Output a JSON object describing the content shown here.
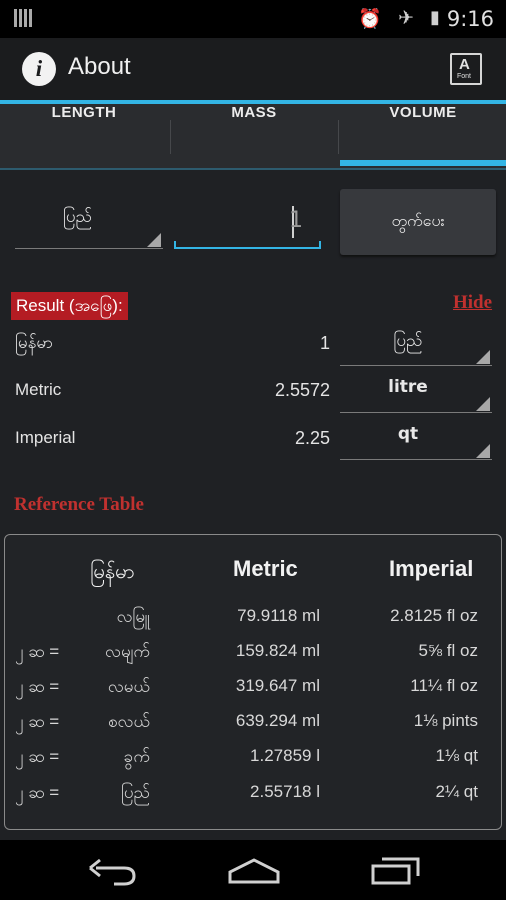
{
  "status_bar": {
    "time": "9:16",
    "icons": [
      "signal-icon",
      "alarm-icon",
      "airplane-icon",
      "battery-charging-icon"
    ]
  },
  "action_bar": {
    "title": "About",
    "info_icon": "info-icon",
    "font_button_letter": "A",
    "font_button_small": "Font"
  },
  "tabs": [
    {
      "label": "LENGTH",
      "selected": false
    },
    {
      "label": "MASS",
      "selected": false
    },
    {
      "label": "VOLUME",
      "selected": true
    }
  ],
  "input": {
    "unit": "ပြည်",
    "amount": "1",
    "calculate_label": "တွက်ပေး"
  },
  "result": {
    "label": "Result (အဖြေ):",
    "hide_label": "Hide",
    "rows": [
      {
        "label": "မြန်မာ",
        "value": "1",
        "unit": "ပြည်"
      },
      {
        "label": "Metric",
        "value": "2.5572",
        "unit": "litre"
      },
      {
        "label": "Imperial",
        "value": "2.25",
        "unit": "qt"
      }
    ]
  },
  "reference": {
    "title": "Reference Table",
    "headers": [
      "မြန်မာ",
      "Metric",
      "Imperial"
    ],
    "rows": [
      {
        "prefix": "",
        "name": "လမြူ",
        "metric": "79.9118 ml",
        "imperial": "2.8125 fl oz"
      },
      {
        "prefix": "၂ ဆ =",
        "name": "လမျက်",
        "metric": "159.824 ml",
        "imperial": "5⅝ fl oz"
      },
      {
        "prefix": "၂ ဆ =",
        "name": "လမယ်",
        "metric": "319.647 ml",
        "imperial": "11¼ fl oz"
      },
      {
        "prefix": "၂ ဆ =",
        "name": "စလယ်",
        "metric": "639.294 ml",
        "imperial": "1⅛ pints"
      },
      {
        "prefix": "၂ ဆ =",
        "name": "ခွက်",
        "metric": "1.27859 l",
        "imperial": "1⅛ qt"
      },
      {
        "prefix": "၂ ဆ =",
        "name": "ပြည်",
        "metric": "2.55718 l",
        "imperial": "2¼ qt"
      }
    ]
  },
  "nav_bar": {
    "icons": [
      "back-icon",
      "home-icon",
      "recents-icon"
    ]
  },
  "colors": {
    "accent": "#33b5e5",
    "result_badge": "#b41c23",
    "link_red": "#c0312f",
    "background": "#1f2124"
  }
}
